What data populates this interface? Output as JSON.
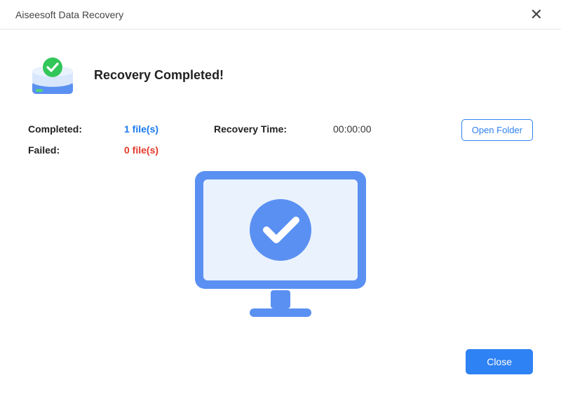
{
  "window": {
    "title": "Aiseesoft Data Recovery"
  },
  "header": {
    "heading": "Recovery Completed!"
  },
  "stats": {
    "completed_label": "Completed:",
    "completed_value": "1 file(s)",
    "failed_label": "Failed:",
    "failed_value": "0 file(s)",
    "recovery_time_label": "Recovery Time:",
    "recovery_time_value": "00:00:00"
  },
  "buttons": {
    "open_folder": "Open Folder",
    "close": "Close"
  },
  "icons": {
    "close_x": "✕"
  }
}
